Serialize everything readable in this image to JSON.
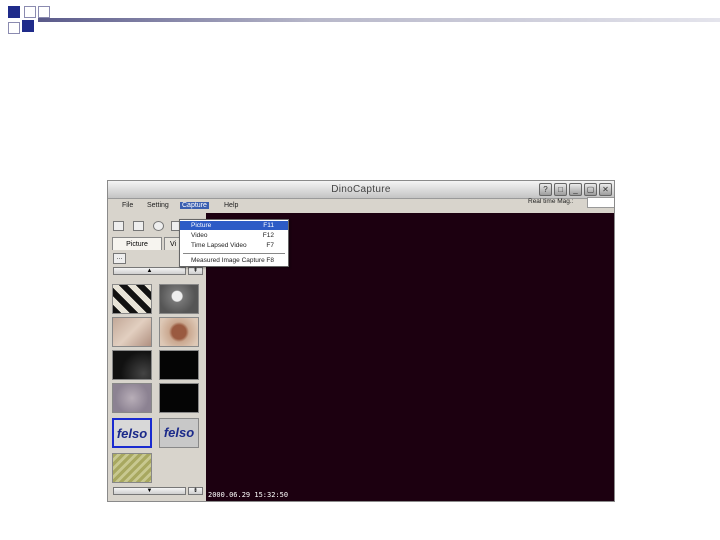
{
  "window": {
    "title": "DinoCapture"
  },
  "menubar": [
    "File",
    "Setting",
    "Capture",
    "Help"
  ],
  "realtime_mag_label": "Real time Mag.:",
  "tabs": [
    "Picture",
    "Vi"
  ],
  "capture_menu": [
    {
      "label": "Picture",
      "shortcut": "F11"
    },
    {
      "label": "Video",
      "shortcut": "F12"
    },
    {
      "label": "Time Lapsed Video",
      "shortcut": "F7"
    },
    {
      "label": "Measured Image Capture",
      "shortcut": "F8"
    }
  ],
  "thumbnail_text": "felso",
  "timestamp": "2000.06.29 15:32:50",
  "colors": {
    "viewer_bg": "#1c0010",
    "highlight": "#2d5bc6",
    "selected_thumb_border": "#1a2bd0"
  }
}
